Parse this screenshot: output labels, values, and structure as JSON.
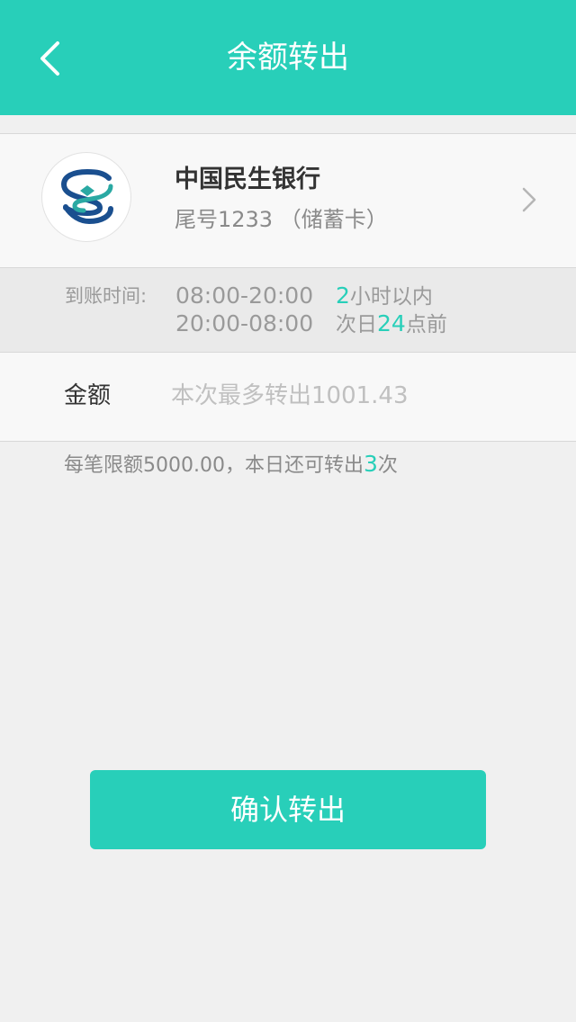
{
  "header": {
    "title": "余额转出",
    "back_icon": "back-arrow-icon",
    "background": "#28cfb9"
  },
  "bank": {
    "name": "中国民生银行",
    "card_info": "尾号1233 （储蓄卡）",
    "logo_icon": "minsheng-bank-logo-icon",
    "chevron_icon": "chevron-right-icon"
  },
  "arrival": {
    "label": "到账时间:",
    "rows": [
      {
        "range": "08:00-20:00",
        "prefix": "",
        "highlight": "2",
        "suffix": "小时以内"
      },
      {
        "range": "20:00-08:00",
        "prefix": "次日",
        "highlight": "24",
        "suffix": "点前"
      }
    ]
  },
  "amount": {
    "label": "金额",
    "placeholder": "本次最多转出1001.43",
    "value": ""
  },
  "limit": {
    "text": "每笔限额5000.00，本日还可转出",
    "count": "3",
    "unit": "次"
  },
  "confirm": {
    "label": "确认转出"
  },
  "colors": {
    "accent": "#28cfb9",
    "logo_dark": "#1a4f8f",
    "logo_teal": "#2aa9a3"
  }
}
